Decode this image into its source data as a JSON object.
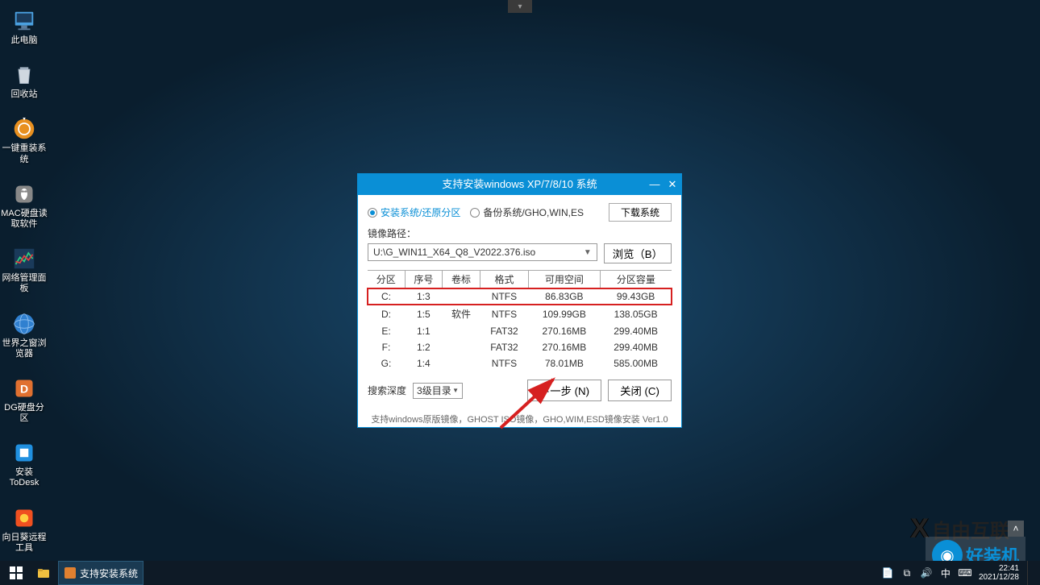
{
  "desktop_icons": [
    {
      "label": "此电脑",
      "dn": "this-pc-icon"
    },
    {
      "label": "回收站",
      "dn": "recycle-bin-icon"
    },
    {
      "label": "一键重装系统",
      "dn": "reinstall-icon"
    },
    {
      "label": "MAC硬盘读取软件",
      "dn": "mac-disk-icon"
    },
    {
      "label": "网络管理面板",
      "dn": "network-panel-icon"
    },
    {
      "label": "世界之窗浏览器",
      "dn": "theworld-browser-icon"
    },
    {
      "label": "DG硬盘分区",
      "dn": "diskgenius-icon"
    },
    {
      "label": "安装ToDesk",
      "dn": "todesk-icon"
    },
    {
      "label": "向日葵远程工具",
      "dn": "sunlogin-icon"
    }
  ],
  "dialog": {
    "title": "支持安装windows XP/7/8/10 系统",
    "radio1": "安装系统/还原分区",
    "radio2": "备份系统/GHO,WIN,ES",
    "download": "下载系统",
    "path_label": "镜像路径：",
    "path_value": "U:\\G_WIN11_X64_Q8_V2022.376.iso",
    "browse": "浏览（B）",
    "headers": [
      "分区",
      "序号",
      "卷标",
      "格式",
      "可用空间",
      "分区容量"
    ],
    "rows": [
      {
        "p": "C:",
        "n": "1:3",
        "v": "",
        "f": "NTFS",
        "free": "86.83GB",
        "size": "99.43GB",
        "hl": true
      },
      {
        "p": "D:",
        "n": "1:5",
        "v": "软件",
        "f": "NTFS",
        "free": "109.99GB",
        "size": "138.05GB",
        "hl": false
      },
      {
        "p": "E:",
        "n": "1:1",
        "v": "",
        "f": "FAT32",
        "free": "270.16MB",
        "size": "299.40MB",
        "hl": false
      },
      {
        "p": "F:",
        "n": "1:2",
        "v": "",
        "f": "FAT32",
        "free": "270.16MB",
        "size": "299.40MB",
        "hl": false
      },
      {
        "p": "G:",
        "n": "1:4",
        "v": "",
        "f": "NTFS",
        "free": "78.01MB",
        "size": "585.00MB",
        "hl": false
      }
    ],
    "depth_label": "搜索深度",
    "depth_value": "3级目录",
    "next": "下一步 (N)",
    "close": "关闭 (C)",
    "footer": "支持windows原版镜像，GHOST ISO镜像，GHO,WIM,ESD镜像安装 Ver1.0"
  },
  "watermark1": "自由互联",
  "watermark2": "好装机",
  "taskbar": {
    "app": "支持安装系统",
    "time": "22:41",
    "date": "2021/12/28"
  }
}
